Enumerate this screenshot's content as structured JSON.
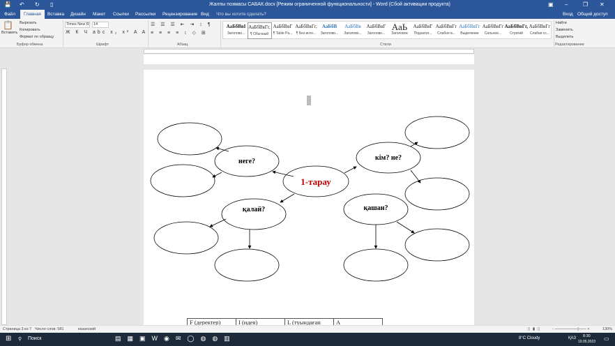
{
  "window": {
    "title": "Жалпы позмасы САБАК.docx [Режим ограниченной функциональности] - Word (Сбой активации продукта)",
    "signin": "Вход",
    "share": "Общий доступ"
  },
  "tabs": [
    "Файл",
    "Главная",
    "Вставка",
    "Дизайн",
    "Макет",
    "Ссылки",
    "Рассылки",
    "Рецензирование",
    "Вид"
  ],
  "tell_me": "Что вы хотите сделать?",
  "clipboard": {
    "paste": "Вставить",
    "cut": "Вырезать",
    "copy": "Копировать",
    "format": "Формат по образцу",
    "group": "Буфер обмена"
  },
  "font": {
    "name": "Times New R",
    "size": "14",
    "group": "Шрифт"
  },
  "paragraph": {
    "group": "Абзац"
  },
  "styles": {
    "group": "Стили",
    "items": [
      {
        "sample": "АаБбВвІ",
        "name": "Заголово..."
      },
      {
        "sample": "АаБбВвГг,",
        "name": "¶ Обычный"
      },
      {
        "sample": "АаБбВвГ",
        "name": "¶ Table Pa..."
      },
      {
        "sample": "АаБбВвГг,",
        "name": "¶ Без инте..."
      },
      {
        "sample": "АаБбВ",
        "name": "Заголово..."
      },
      {
        "sample": "АаБбВв",
        "name": "Заголово..."
      },
      {
        "sample": "АаБбВвГ",
        "name": "Заголово..."
      },
      {
        "sample": "АаЬ",
        "name": "Заголовок"
      },
      {
        "sample": "АаБбВвГ",
        "name": "Подзагол..."
      },
      {
        "sample": "АаБбВвГг",
        "name": "Слабое в..."
      },
      {
        "sample": "АаБбВвГг",
        "name": "Выделение"
      },
      {
        "sample": "АаБбВвГг",
        "name": "Сильное..."
      },
      {
        "sample": "АаБбВвГг,",
        "name": "Строгий"
      },
      {
        "sample": "АаБбВвГг",
        "name": "Слабая сс..."
      }
    ]
  },
  "editing": {
    "find": "Найти",
    "replace": "Заменить",
    "select": "Выделить",
    "group": "Редактирование"
  },
  "diagram": {
    "center": "1-тарау",
    "nodes": [
      "неге?",
      "кім? не?",
      "қалай?",
      "қашан?"
    ],
    "center_color": "#c00000"
  },
  "table": {
    "headers": [
      "F (деректер)",
      "I (идея)",
      "L (туындаған",
      "A"
    ]
  },
  "status": {
    "page": "Страница 3 из 7",
    "words": "Число слов: 581",
    "lang": "казахский",
    "zoom": "130%"
  },
  "taskbar": {
    "search": "Поиск",
    "weather": "8°C Cloudy",
    "lang": "ҚАЗ",
    "time": "8:30",
    "date": "19.05.2023"
  }
}
